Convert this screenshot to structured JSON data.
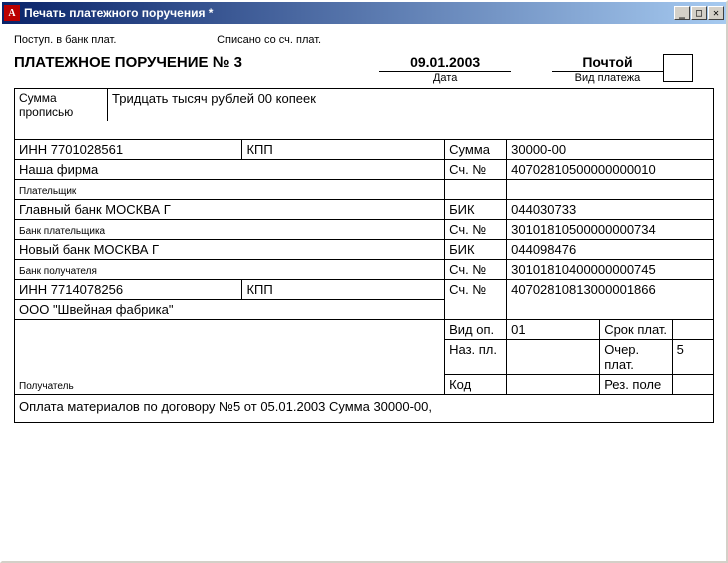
{
  "window": {
    "title": "Печать платежного поручения  *"
  },
  "topline": {
    "received": "Поступ. в банк плат.",
    "debited": "Списано со сч. плат."
  },
  "header": {
    "doc_title_prefix": "ПЛАТЕЖНОЕ ПОРУЧЕНИЕ № ",
    "doc_number": "3",
    "date": "09.01.2003",
    "date_label": "Дата",
    "payment_type": "Почтой",
    "payment_type_label": "Вид платежа"
  },
  "amount_words": {
    "label": "Сумма прописью",
    "value": "Тридцать тысяч рублей 00 копеек"
  },
  "payer": {
    "inn_label": "ИНН",
    "inn": "7701028561",
    "kpp_label": "КПП",
    "kpp": "",
    "name": "Наша фирма",
    "role_label": "Плательщик",
    "amount_label": "Сумма",
    "amount": "30000-00",
    "account_label": "Сч. №",
    "account": "40702810500000000010"
  },
  "payer_bank": {
    "name": "Главный банк МОСКВА Г",
    "role_label": "Банк плательщика",
    "bik_label": "БИК",
    "bik": "044030733",
    "account_label": "Сч. №",
    "account": "30101810500000000734"
  },
  "payee_bank": {
    "name": "Новый банк МОСКВА Г",
    "role_label": "Банк получателя",
    "bik_label": "БИК",
    "bik": "044098476",
    "account_label": "Сч. №",
    "account": "30101810400000000745"
  },
  "payee": {
    "inn_label": "ИНН",
    "inn": "7714078256",
    "kpp_label": "КПП",
    "kpp": "",
    "account_label": "Сч. №",
    "account": "40702810813000001866",
    "name": "ООО \"Швейная фабрика\"",
    "role_label": "Получатель"
  },
  "footer": {
    "vid_op_label": "Вид оп.",
    "vid_op": "01",
    "srok_label": "Срок плат.",
    "srok": "",
    "naz_pl_label": "Наз. пл.",
    "naz_pl": "",
    "ocher_label": "Очер. плат.",
    "ocher": "5",
    "kod_label": "Код",
    "kod": "",
    "rez_label": "Рез. поле",
    "rez": ""
  },
  "purpose": "Оплата материалов по договору №5 от 05.01.2003 Сумма 30000-00,"
}
